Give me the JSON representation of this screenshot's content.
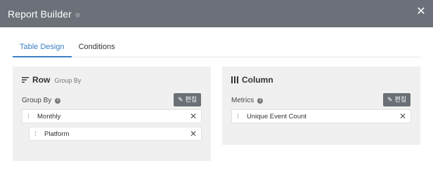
{
  "dialog": {
    "title": "Report Builder",
    "close_icon": "close-icon"
  },
  "tabs": [
    {
      "label": "Table Design",
      "active": true
    },
    {
      "label": "Conditions",
      "active": false
    }
  ],
  "row_panel": {
    "title": "Row",
    "subtitle": "Group By",
    "field_label": "Group By",
    "edit_label": "편집",
    "items": [
      {
        "label": "Monthly"
      },
      {
        "label": "Platform"
      }
    ]
  },
  "column_panel": {
    "title": "Column",
    "field_label": "Metrics",
    "edit_label": "편집",
    "items": [
      {
        "label": "Unique Event Count"
      }
    ]
  },
  "colors": {
    "titlebar": "#6c7179",
    "accent": "#3b7fc4",
    "panel": "#f0f0f0",
    "button": "#6b6f76"
  }
}
